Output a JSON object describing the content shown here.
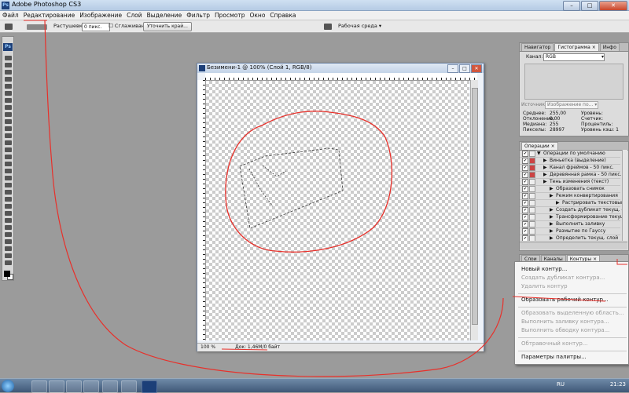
{
  "window": {
    "title": "Adobe Photoshop CS3"
  },
  "menu": [
    "Файл",
    "Редактирование",
    "Изображение",
    "Слой",
    "Выделение",
    "Фильтр",
    "Просмотр",
    "Окно",
    "Справка"
  ],
  "options": {
    "feather_label": "Растушевка:",
    "feather_value": "0 пикс.",
    "antialias_label": "Сглаживание",
    "refine_button": "Уточнить край...",
    "workspace_label": "Рабочая среда ▾"
  },
  "document": {
    "title": "Безимени-1 @ 100% (Слой 1, RGB/8)",
    "zoom": "100 %",
    "info": "Док: 1,46М/0 байт"
  },
  "navigator_panel": {
    "tabs": [
      "Навигатор",
      "Гистограмма ×",
      "Инфо"
    ],
    "channel_label": "Канал:",
    "channel_value": "RGB",
    "source_label": "Источник:",
    "source_value": "Изображение по...",
    "stats_left": [
      [
        "Среднее:",
        "255,00"
      ],
      [
        "Отклонение:",
        "0,00"
      ],
      [
        "Медиана:",
        "255"
      ],
      [
        "Пикселы:",
        "28997"
      ]
    ],
    "stats_right": [
      "Уровень:",
      "Счетчик:",
      "Процентиль:",
      "Уровень кэш: 1"
    ]
  },
  "operations_panel": {
    "tab": "Операции ×",
    "items": [
      {
        "label": "Операции по умолчанию",
        "indent": 0,
        "dlg": ""
      },
      {
        "label": "Виньетка (выделение)",
        "indent": 1,
        "dlg": "red"
      },
      {
        "label": "Канал фреймов - 50 пикс.",
        "indent": 1,
        "dlg": "red"
      },
      {
        "label": "Деревянная рамка - 50 пикс.",
        "indent": 1,
        "dlg": "red"
      },
      {
        "label": "Тень изменения (текст)",
        "indent": 1,
        "dlg": ""
      },
      {
        "label": "Образовать снимок",
        "indent": 2,
        "dlg": ""
      },
      {
        "label": "Режим конвертирования",
        "indent": 2,
        "dlg": ""
      },
      {
        "label": "Растрировать текстовый слой",
        "indent": 3,
        "dlg": ""
      },
      {
        "label": "Создать дубликат текущ. слой",
        "indent": 2,
        "dlg": ""
      },
      {
        "label": "Трансформирование текущ. слой",
        "indent": 2,
        "dlg": ""
      },
      {
        "label": "Выполнить заливку",
        "indent": 2,
        "dlg": ""
      },
      {
        "label": "Размытие по Гауссу",
        "indent": 2,
        "dlg": ""
      },
      {
        "label": "Определить текущ. слой",
        "indent": 2,
        "dlg": ""
      }
    ]
  },
  "layers_panel": {
    "tabs": [
      "Слои",
      "Каналы",
      "Контуры ×"
    ]
  },
  "context_menu": {
    "items": [
      {
        "label": "Новый контур...",
        "disabled": false
      },
      {
        "label": "Создать дубликат контура...",
        "disabled": true
      },
      {
        "label": "Удалить контур",
        "disabled": true
      },
      {
        "sep": true
      },
      {
        "label": "Образовать рабочий контур...",
        "disabled": false
      },
      {
        "sep": true
      },
      {
        "label": "Образовать выделенную область...",
        "disabled": true
      },
      {
        "label": "Выполнить заливку контура...",
        "disabled": true
      },
      {
        "label": "Выполнить обводку контура...",
        "disabled": true
      },
      {
        "sep": true
      },
      {
        "label": "Обтравочный контур...",
        "disabled": true
      },
      {
        "sep": true
      },
      {
        "label": "Параметры палитры...",
        "disabled": false
      }
    ]
  },
  "taskbar": {
    "lang": "RU",
    "time": "21:23"
  },
  "annotation_color": "#e8302a"
}
